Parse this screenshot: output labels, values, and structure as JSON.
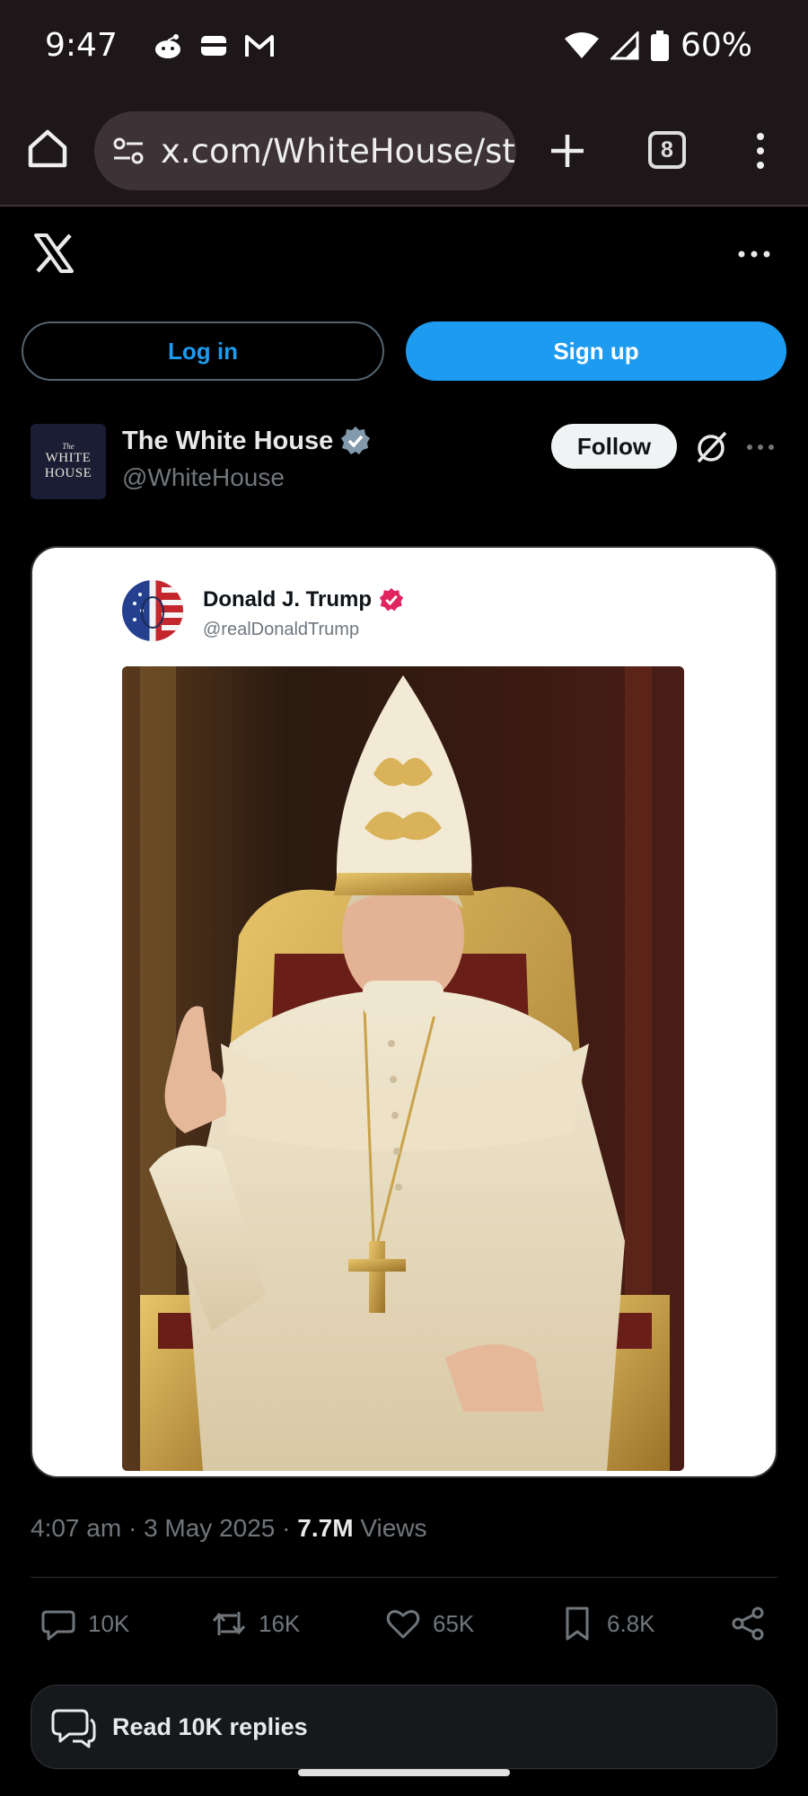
{
  "status_bar": {
    "time": "9:47",
    "battery": "60%",
    "left_icons": [
      "reddit-icon",
      "wallet-icon",
      "gmail-icon"
    ],
    "right_icons": [
      "wifi-icon",
      "cellular-signal-icon",
      "battery-icon"
    ]
  },
  "browser": {
    "url": "x.com/WhiteHouse/st",
    "tab_count": "8",
    "icons": [
      "home-icon",
      "site-settings-icon",
      "plus-icon",
      "tabs-icon",
      "kebab-menu-icon"
    ]
  },
  "x_header": {
    "login_label": "Log in",
    "signup_label": "Sign up"
  },
  "post": {
    "author_name": "The White House",
    "author_handle": "@WhiteHouse",
    "avatar_text": [
      "The",
      "WHITE",
      "HOUSE"
    ],
    "follow_label": "Follow",
    "embedded": {
      "name": "Donald J. Trump",
      "handle": "@realDonaldTrump"
    },
    "time": "4:07 am",
    "date": "3 May 2025",
    "views_count": "7.7M",
    "views_label": "Views",
    "replies": "10K",
    "reposts": "16K",
    "likes": "65K",
    "bookmarks": "6.8K",
    "read_replies_label": "Read 10K replies"
  },
  "colors": {
    "accent": "#1d9bf0",
    "verified_gov": "#829aab",
    "verified_pink": "#e0245e",
    "background": "#000000",
    "browser_chrome": "#1e1719"
  }
}
